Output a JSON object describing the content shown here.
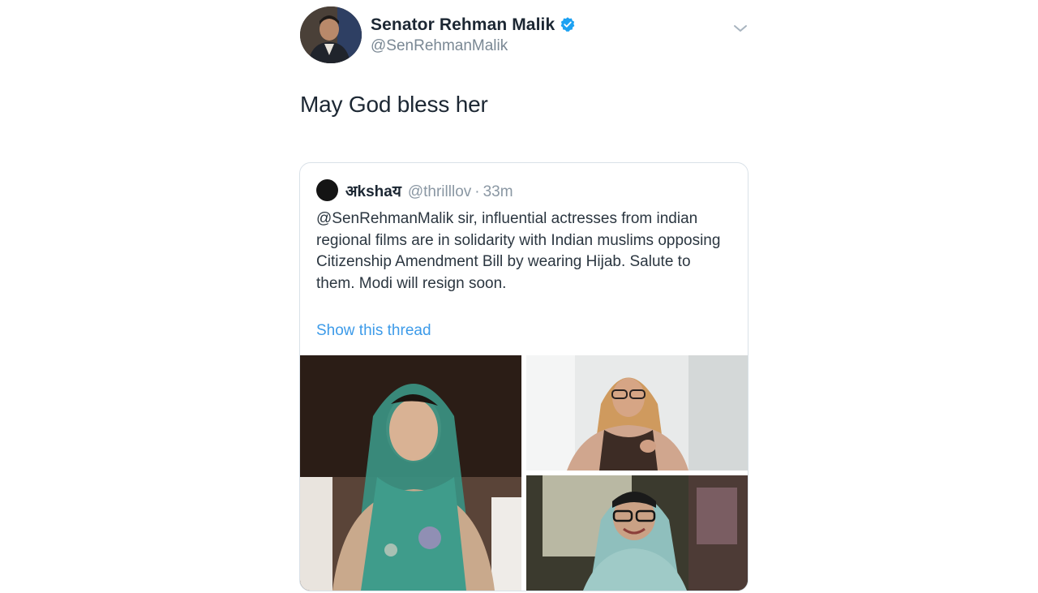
{
  "tweet": {
    "author_name": "Senator Rehman Malik",
    "author_handle": "@SenRehmanMalik",
    "text": "May God bless her",
    "icons": {
      "avatar": "profile-avatar",
      "verified": "verified-badge-icon",
      "menu": "chevron-down-icon"
    },
    "colors": {
      "verified": "#1da1f2",
      "link": "#3d9be9"
    }
  },
  "quoted_tweet": {
    "author_name": "अkshaय",
    "author_handle": "@thrilllov",
    "separator": "·",
    "time": "33m",
    "text": "@SenRehmanMalik sir, influential actresses from indian regional films are in solidarity with Indian muslims opposing Citizenship Amendment Bill by wearing Hijab. Salute to them. Modi will resign soon.",
    "show_thread": "Show this thread",
    "media": [
      {
        "name": "photo-woman-green-hijab"
      },
      {
        "name": "photo-woman-orange-hijab-glasses"
      },
      {
        "name": "photo-woman-blue-hijab-glasses"
      }
    ]
  }
}
